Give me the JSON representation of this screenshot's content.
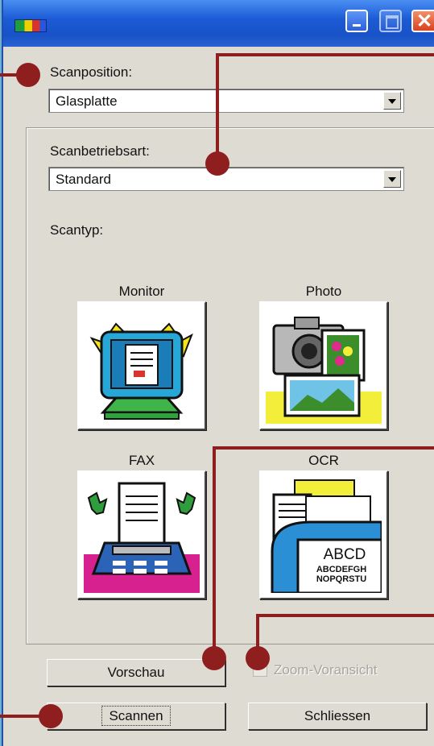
{
  "window": {
    "controls": {
      "minimize": "minimize",
      "maximize": "maximize",
      "close": "✕"
    }
  },
  "scan_position": {
    "label": "Scanposition:",
    "value": "Glasplatte"
  },
  "scan_mode": {
    "label": "Scanbetriebsart:",
    "value": "Standard"
  },
  "scan_type": {
    "label": "Scantyp:",
    "options": [
      {
        "label": "Monitor",
        "icon": "monitor-icon"
      },
      {
        "label": "Photo",
        "icon": "camera-photo-icon"
      },
      {
        "label": "FAX",
        "icon": "fax-icon"
      },
      {
        "label": "OCR",
        "icon": "ocr-document-icon"
      }
    ]
  },
  "ocr_text": {
    "line1": "ABCD",
    "line2": "ABCDEFGH",
    "line3": "NOPQRSTU"
  },
  "buttons": {
    "preview": "Vorschau",
    "zoom_preview": "Zoom-Voransicht",
    "scan": "Scannen",
    "close": "Schliessen"
  },
  "colors": {
    "callout": "#8f1e1e",
    "background": "#6fb0d6",
    "titlebar": "#1c5bd6"
  }
}
